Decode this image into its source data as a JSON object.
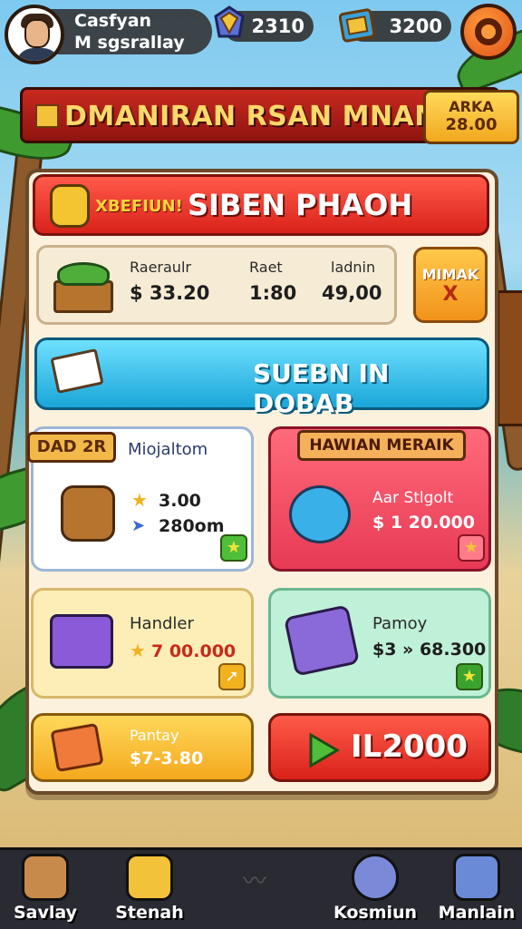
{
  "player": {
    "name": "Casfyan",
    "subtitle": "M sgsrallay"
  },
  "resources": [
    {
      "icon": "gem-icon",
      "value": "2310"
    },
    {
      "icon": "ticket-icon",
      "value": "3200"
    }
  ],
  "settings_icon": "gear-icon",
  "title_banner": {
    "title": "DMANIRAN RSAN MNAN",
    "price_label": "ARKA",
    "price_value": "28.00"
  },
  "promo_bar": {
    "tag": "XBEFIUN!",
    "title": "SIBEN PHAOH"
  },
  "info_card": {
    "columns": [
      {
        "header": "Raeraulr",
        "value": "$ 33.20"
      },
      {
        "header": "Raet",
        "value": "1:80"
      },
      {
        "header": "ladnin",
        "value": "49,00"
      }
    ]
  },
  "side_button": {
    "line1": "MIMAK",
    "line2": "X"
  },
  "blue_bar": {
    "label": "SUEBN IN DOBAB"
  },
  "cards": {
    "card1": {
      "ribbon": "DAD 2R",
      "name": "Miojaltom",
      "stat1": "3.00",
      "stat2": "280om"
    },
    "card2": {
      "ribbon": "HAWIAN MERAIK",
      "name": "Aar Stlgolt",
      "value": "$ 1 20.000"
    },
    "card3": {
      "name": "Handler",
      "value": "7 00.000"
    },
    "card4": {
      "name": "Pamoy",
      "value": "$3 » 68.300"
    },
    "card5": {
      "name": "Pantay",
      "value": "$7-3.80"
    },
    "card6": {
      "value": "IL2000"
    }
  },
  "nav": [
    {
      "label": "Savlay",
      "icon": "character-icon"
    },
    {
      "label": "Stenah",
      "icon": "device-icon"
    },
    {
      "label": "",
      "icon": "wave-icon"
    },
    {
      "label": "Kosmiun",
      "icon": "key-icon"
    },
    {
      "label": "Manlain",
      "icon": "robot-icon"
    }
  ],
  "colors": {
    "red": "#d9221a",
    "blue": "#1aa6d8",
    "gold": "#f2a81e",
    "green": "#3aa32e",
    "panel": "#fbf1dc"
  }
}
